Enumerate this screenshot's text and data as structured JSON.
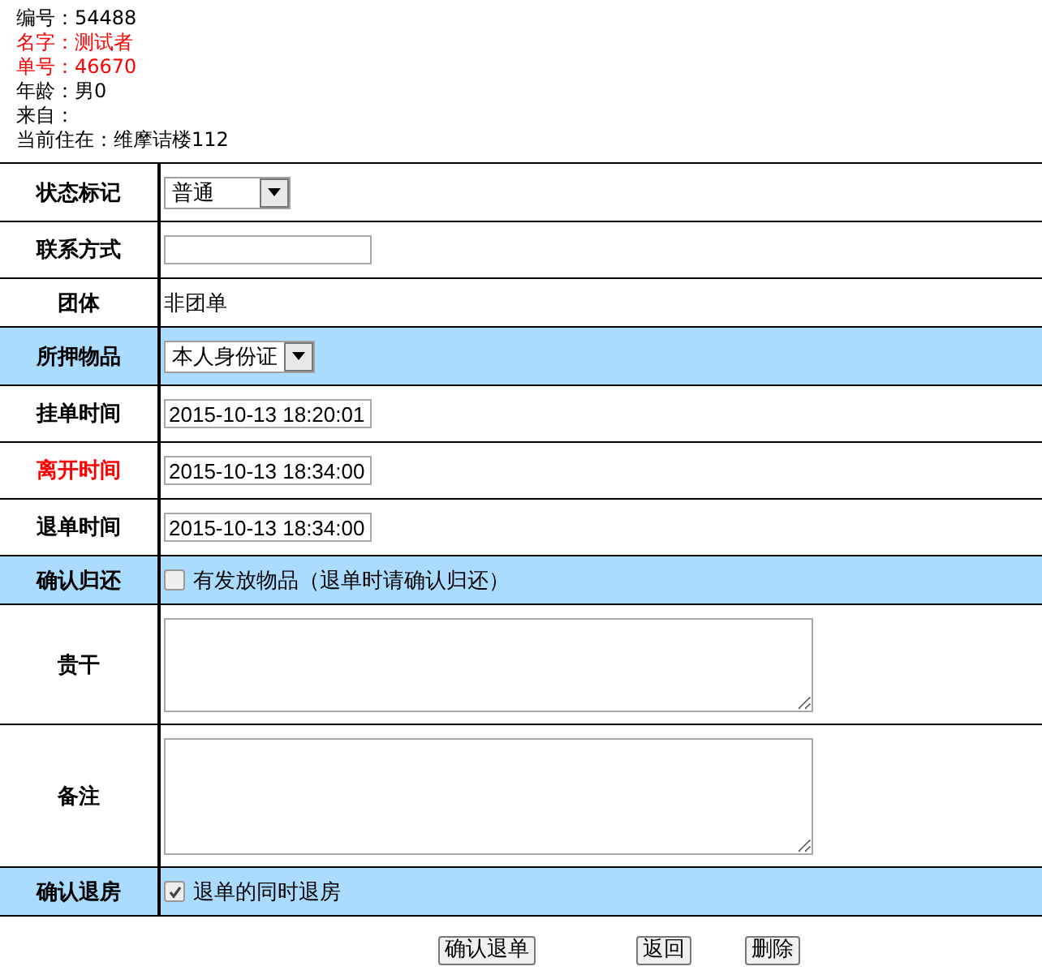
{
  "info_lines": [
    {
      "text": "编号：54488",
      "warning": false
    },
    {
      "text": "名字：测试者",
      "warning": true
    },
    {
      "text": "单号：46670",
      "warning": true
    },
    {
      "text": "年龄：男0",
      "warning": false
    },
    {
      "text": "来自：",
      "warning": false
    },
    {
      "text": "当前住在：维摩诘楼112",
      "warning": false
    }
  ],
  "form_rows": [
    {
      "label": "状态标记",
      "kind": "select",
      "value": "普通",
      "highlighted": false,
      "warning": false
    },
    {
      "label": "联系方式",
      "kind": "input",
      "highlighted": false,
      "warning": false
    },
    {
      "label": "团体",
      "kind": "text",
      "value": "非团单",
      "highlighted": false,
      "warning": false
    },
    {
      "label": "所押物品",
      "kind": "select",
      "value": "本人身份证",
      "highlighted": true,
      "warning": false
    },
    {
      "label": "挂单时间",
      "kind": "input",
      "value": "2015-10-13 18:20:01",
      "highlighted": false,
      "warning": false
    },
    {
      "label": "离开时间",
      "kind": "input",
      "value": "2015-10-13 18:34:00",
      "highlighted": false,
      "warning": true
    },
    {
      "label": "退单时间",
      "kind": "input",
      "value": "2015-10-13 18:34:00",
      "highlighted": false,
      "warning": false
    },
    {
      "label": "确认归还",
      "kind": "checkbox",
      "value": "有发放物品（退单时请确认归还）",
      "checked": false,
      "highlighted": true,
      "warning": false
    },
    {
      "label": "贵干",
      "kind": "textarea",
      "highlighted": false,
      "warning": false
    },
    {
      "label": "备注",
      "kind": "textarea",
      "highlighted": false,
      "warning": false
    },
    {
      "label": "确认退房",
      "kind": "checkbox",
      "value": "退单的同时退房",
      "checked": true,
      "highlighted": true,
      "warning": false
    }
  ],
  "buttons": [
    "确认退单",
    "返回",
    "删除"
  ]
}
